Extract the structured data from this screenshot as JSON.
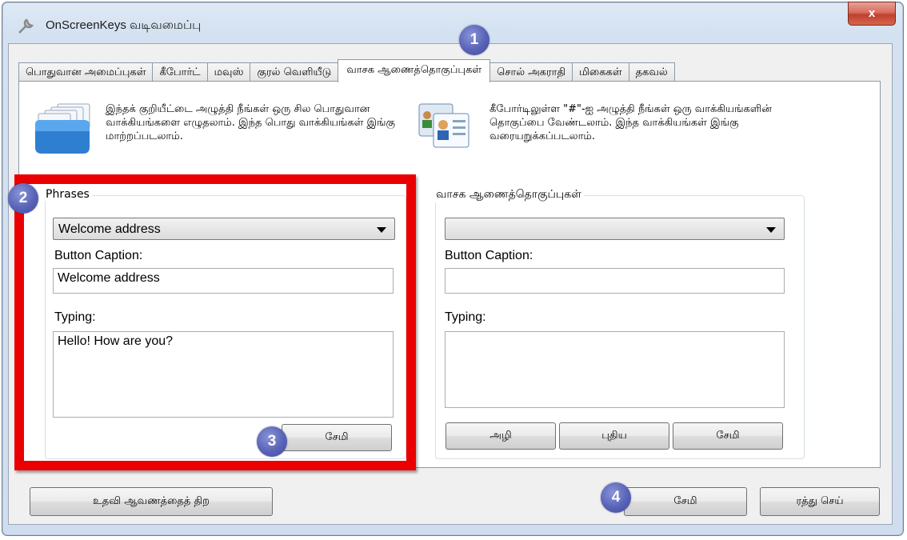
{
  "window": {
    "title": "OnScreenKeys வடிவமைப்பு",
    "close_label": "x"
  },
  "tabs": [
    {
      "label": "பொதுவான அமைப்புகள்"
    },
    {
      "label": "கீபோர்ட்"
    },
    {
      "label": "மவுஸ்"
    },
    {
      "label": "குரல் வெளியீடு"
    },
    {
      "label": "வாசக ஆணைத்தொகுப்புகள்"
    },
    {
      "label": "சொல் அகராதி"
    },
    {
      "label": "மிகைகள்"
    },
    {
      "label": "தகவல்"
    }
  ],
  "active_tab_index": 4,
  "info": {
    "left": "இந்தக் குறியீட்டை அழுத்தி நீங்கள் ஒரு சில பொதுவான வாக்கியங்களை எழுதலாம். இந்த பொது வாக்கியங்கள் இங்கு மாற்றப்படலாம்.",
    "right": "கீபோர்டிலுள்ள \"#\"-ஐ அழுத்தி நீங்கள் ஒரு வாக்கியங்களின் தொகுப்பை வேண்டலாம். இந்த வாக்கியங்கள் இங்கு வரையறுக்கப்படலாம்."
  },
  "phrases": {
    "group_label": "Phrases",
    "selected": "Welcome address",
    "caption_label": "Button Caption:",
    "caption_value": "Welcome address",
    "typing_label": "Typing:",
    "typing_value": "Hello! How are you?",
    "save_label": "சேமி"
  },
  "commands": {
    "group_label": "வாசக ஆணைத்தொகுப்புகள்",
    "selected": "",
    "caption_label": "Button Caption:",
    "caption_value": "",
    "typing_label": "Typing:",
    "typing_value": "",
    "delete_label": "அழி",
    "new_label": "புதிய",
    "save_label": "சேமி"
  },
  "footer": {
    "help_label": "உதவி ஆவணத்தைத் திற",
    "save_label": "சேமி",
    "cancel_label": "ரத்து செய்"
  },
  "badges": [
    "1",
    "2",
    "3",
    "4"
  ],
  "colors": {
    "highlight": "#ea0000",
    "badge": "#5863b7"
  }
}
